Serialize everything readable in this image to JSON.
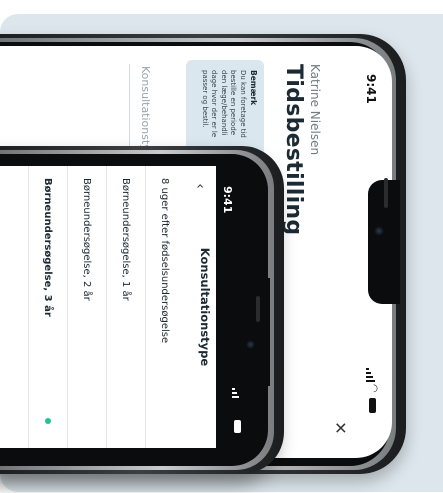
{
  "colors": {
    "background": "#dce6ec",
    "accent": "#1fc39a",
    "note_background": "#dbe7ef",
    "title_text": "#1b2a33"
  },
  "phone_back": {
    "status_time": "9:41",
    "close_icon": "close-icon",
    "subtitle": "Katrine Nielsen",
    "title": "Tidsbestilling",
    "note": {
      "heading": "Bemærk",
      "lines": [
        "Du kan foretage tid",
        "bestille en periode",
        "den læge/behandli",
        "dage hvor der er le",
        "passer og bestil."
      ]
    },
    "field_label": "Konsultationstyp"
  },
  "phone_front": {
    "status_time": "9:41",
    "back_icon": "chevron-left-icon",
    "header_title": "Konsultationstype",
    "options": [
      {
        "label": "8 uger efter fødselsundersøgelse",
        "selected": false
      },
      {
        "label": "Børneundersøgelse, 1 år",
        "selected": false
      },
      {
        "label": "Børneundersøgelse, 2 år",
        "selected": false
      },
      {
        "label": "Børneundersøgelse, 3 år",
        "selected": true
      }
    ]
  }
}
